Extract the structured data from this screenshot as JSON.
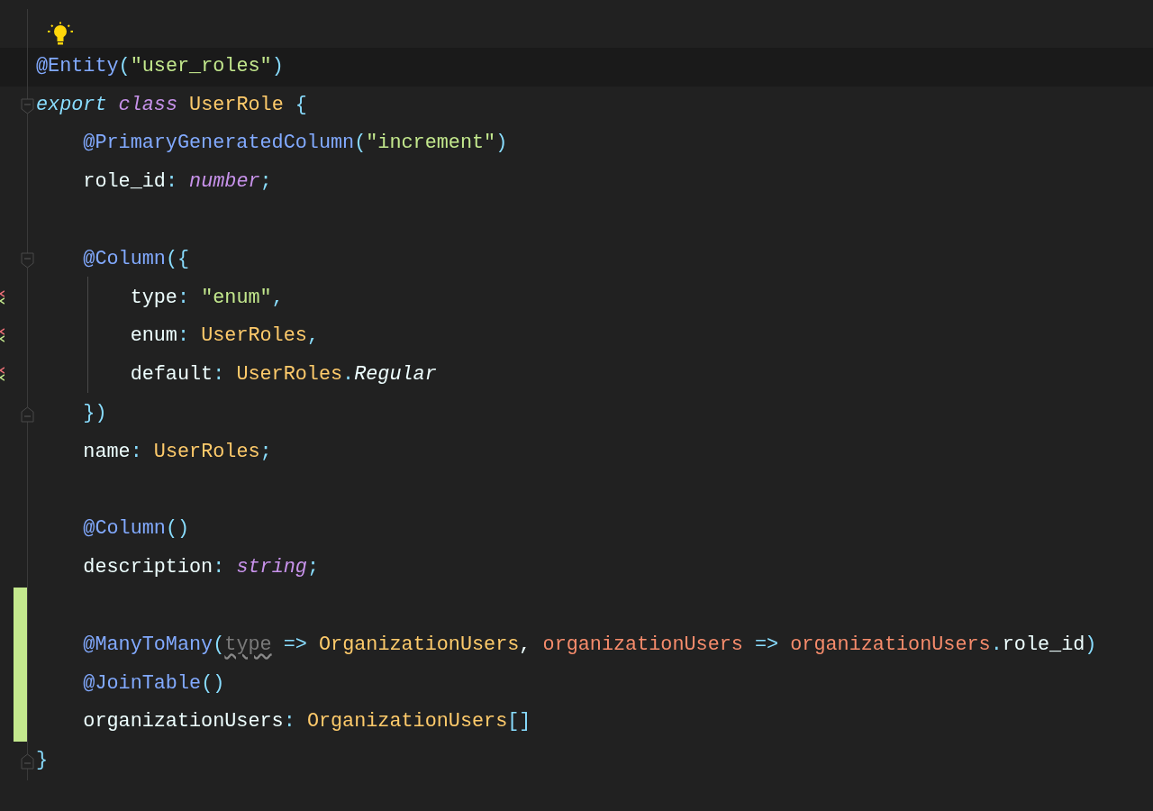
{
  "lines": [
    {
      "kind": "lightbulb"
    },
    {
      "kind": "code",
      "current": true,
      "tokens": [
        {
          "kind": "decorator",
          "t": "@Entity"
        },
        {
          "kind": "punct",
          "t": "("
        },
        {
          "kind": "string",
          "t": "\"user_roles\""
        },
        {
          "kind": "punct",
          "t": ")"
        }
      ]
    },
    {
      "kind": "code",
      "fold_start": true,
      "tokens": [
        {
          "kind": "storage",
          "t": "export"
        },
        {
          "kind": "keyword",
          "t": "class",
          "space": true
        },
        {
          "kind": "type",
          "t": "UserRole",
          "space": true
        },
        {
          "kind": "punct",
          "t": "{",
          "space": true
        }
      ],
      "children": [
        {
          "kind": "code",
          "tokens": [
            {
              "kind": "decorator",
              "t": "@PrimaryGeneratedColumn"
            },
            {
              "kind": "punct",
              "t": "("
            },
            {
              "kind": "string",
              "t": "\"increment\""
            },
            {
              "kind": "punct",
              "t": ")"
            }
          ]
        },
        {
          "kind": "code",
          "tokens": [
            {
              "kind": "plain",
              "t": "role_id"
            },
            {
              "kind": "punct",
              "t": ":"
            },
            {
              "kind": "builtin",
              "t": "number",
              "space": true
            },
            {
              "kind": "punct",
              "t": ";"
            }
          ]
        },
        {
          "kind": "blank"
        },
        {
          "kind": "code",
          "fold_start": true,
          "tokens": [
            {
              "kind": "decorator",
              "t": "@Column"
            },
            {
              "kind": "punct",
              "t": "({"
            }
          ],
          "children": [
            {
              "kind": "code",
              "guide": true,
              "warning": true,
              "tokens": [
                {
                  "kind": "plain",
                  "t": "type"
                },
                {
                  "kind": "punct",
                  "t": ":"
                },
                {
                  "kind": "string",
                  "t": "\"enum\"",
                  "space": true
                },
                {
                  "kind": "punct",
                  "t": ","
                }
              ]
            },
            {
              "kind": "code",
              "guide": true,
              "warning": true,
              "tokens": [
                {
                  "kind": "plain",
                  "t": "enum"
                },
                {
                  "kind": "punct",
                  "t": ":"
                },
                {
                  "kind": "type",
                  "t": "UserRoles",
                  "space": true
                },
                {
                  "kind": "punct",
                  "t": ","
                }
              ]
            },
            {
              "kind": "code",
              "guide": true,
              "warning": true,
              "tokens": [
                {
                  "kind": "plain",
                  "t": "default"
                },
                {
                  "kind": "punct",
                  "t": ":"
                },
                {
                  "kind": "type",
                  "t": "UserRoles",
                  "space": true
                },
                {
                  "kind": "punct",
                  "t": "."
                },
                {
                  "kind": "italic",
                  "t": "Regular"
                }
              ]
            }
          ]
        },
        {
          "kind": "code",
          "fold_end": true,
          "tokens": [
            {
              "kind": "punct",
              "t": "})"
            }
          ]
        },
        {
          "kind": "code",
          "tokens": [
            {
              "kind": "plain",
              "t": "name"
            },
            {
              "kind": "punct",
              "t": ":"
            },
            {
              "kind": "type",
              "t": "UserRoles",
              "space": true
            },
            {
              "kind": "punct",
              "t": ";"
            }
          ]
        },
        {
          "kind": "blank"
        },
        {
          "kind": "code",
          "tokens": [
            {
              "kind": "decorator",
              "t": "@Column"
            },
            {
              "kind": "punct",
              "t": "()"
            }
          ]
        },
        {
          "kind": "code",
          "tokens": [
            {
              "kind": "plain",
              "t": "description"
            },
            {
              "kind": "punct",
              "t": ":"
            },
            {
              "kind": "builtin",
              "t": "string",
              "space": true
            },
            {
              "kind": "punct",
              "t": ";"
            }
          ]
        },
        {
          "kind": "blank",
          "changed": true
        },
        {
          "kind": "code",
          "changed": true,
          "tokens": [
            {
              "kind": "decorator",
              "t": "@ManyToMany"
            },
            {
              "kind": "punct",
              "t": "("
            },
            {
              "kind": "unused",
              "t": "type"
            },
            {
              "kind": "punct",
              "t": "=>",
              "space": true
            },
            {
              "kind": "type",
              "t": "OrganizationUsers",
              "space": true
            },
            {
              "kind": "plain",
              "t": ","
            },
            {
              "kind": "param",
              "t": "organizationUsers",
              "space": true
            },
            {
              "kind": "punct",
              "t": "=>",
              "space": true
            },
            {
              "kind": "param",
              "t": "organizationUsers",
              "space": true
            },
            {
              "kind": "punct",
              "t": "."
            },
            {
              "kind": "plain",
              "t": "role_id"
            },
            {
              "kind": "punct",
              "t": ")"
            }
          ]
        },
        {
          "kind": "code",
          "changed": true,
          "tokens": [
            {
              "kind": "decorator",
              "t": "@JoinTable"
            },
            {
              "kind": "punct",
              "t": "()"
            }
          ]
        },
        {
          "kind": "code",
          "changed": true,
          "tokens": [
            {
              "kind": "plain",
              "t": "organizationUsers"
            },
            {
              "kind": "punct",
              "t": ":"
            },
            {
              "kind": "type",
              "t": "OrganizationUsers",
              "space": true
            },
            {
              "kind": "punct",
              "t": "[]"
            }
          ]
        }
      ]
    },
    {
      "kind": "code",
      "fold_end": true,
      "tokens": [
        {
          "kind": "punct",
          "t": "}"
        }
      ]
    }
  ]
}
